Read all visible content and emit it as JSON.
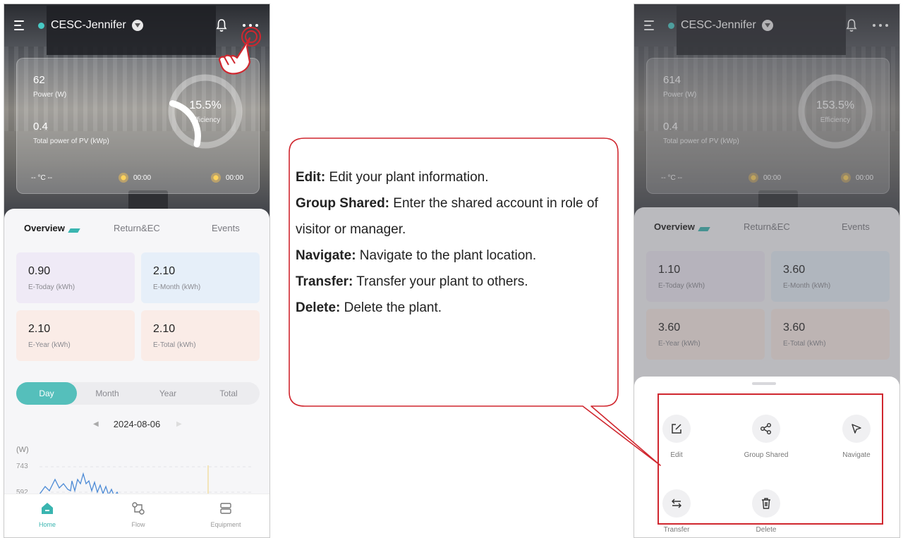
{
  "colors": {
    "accent": "#3ab5b0",
    "status_online": "#47c9c4",
    "callout_border": "#d0272f",
    "tile_today": "#efeaf6",
    "tile_month": "#e6eff9",
    "tile_year": "#faece7",
    "tile_total": "#faece7"
  },
  "left_screen": {
    "header": {
      "plant_name": "CESC-Jennifer",
      "menu_icon": "menu-icon",
      "bell_icon": "bell-icon",
      "more_icon": "more-icon"
    },
    "stats": {
      "power_value": "62",
      "power_label": "Power (W)",
      "pv_value": "0.4",
      "pv_label": "Total power of PV (kWp)",
      "efficiency_value": "15.5%",
      "efficiency_label": "Efficiency",
      "efficiency_fraction": 0.155,
      "temperature": "-- °C --",
      "sunrise": "00:00",
      "sunset": "00:00"
    },
    "tabs": [
      "Overview",
      "Return&EC",
      "Events"
    ],
    "tiles": [
      {
        "value": "0.90",
        "label": "E-Today (kWh)"
      },
      {
        "value": "2.10",
        "label": "E-Month (kWh)"
      },
      {
        "value": "2.10",
        "label": "E-Year (kWh)"
      },
      {
        "value": "2.10",
        "label": "E-Total (kWh)"
      }
    ],
    "periods": [
      "Day",
      "Month",
      "Year",
      "Total"
    ],
    "date": "2024-08-06",
    "chart": {
      "unit": "(W)",
      "y_ticks": [
        "743",
        "592"
      ]
    },
    "nav": [
      {
        "label": "Home",
        "icon": "home-icon"
      },
      {
        "label": "Flow",
        "icon": "flow-icon"
      },
      {
        "label": "Equipment",
        "icon": "equipment-icon"
      }
    ]
  },
  "callout": [
    {
      "term": "Edit:",
      "desc": " Edit your plant information."
    },
    {
      "term": "Group Shared:",
      "desc": " Enter the shared account in role of visitor or manager."
    },
    {
      "term": "Navigate:",
      "desc": " Navigate to the plant location."
    },
    {
      "term": "Transfer:",
      "desc": " Transfer your plant to others."
    },
    {
      "term": "Delete:",
      "desc": " Delete the plant."
    }
  ],
  "right_screen": {
    "header": {
      "plant_name": "CESC-Jennifer"
    },
    "stats": {
      "power_value": "614",
      "power_label": "Power (W)",
      "pv_value": "0.4",
      "pv_label": "Total power of PV (kWp)",
      "efficiency_value": "153.5%",
      "efficiency_label": "Efficiency",
      "temperature": "-- °C --",
      "sunrise": "00:00",
      "sunset": "00:00"
    },
    "tabs": [
      "Overview",
      "Return&EC",
      "Events"
    ],
    "tiles": [
      {
        "value": "1.10",
        "label": "E-Today (kWh)"
      },
      {
        "value": "3.60",
        "label": "E-Month (kWh)"
      },
      {
        "value": "3.60",
        "label": "E-Year (kWh)"
      },
      {
        "value": "3.60",
        "label": "E-Total (kWh)"
      }
    ],
    "actions": [
      {
        "label": "Edit",
        "icon": "edit-icon"
      },
      {
        "label": "Group Shared",
        "icon": "share-icon"
      },
      {
        "label": "Navigate",
        "icon": "navigate-icon"
      },
      {
        "label": "Transfer",
        "icon": "transfer-icon"
      },
      {
        "label": "Delete",
        "icon": "delete-icon"
      }
    ]
  }
}
